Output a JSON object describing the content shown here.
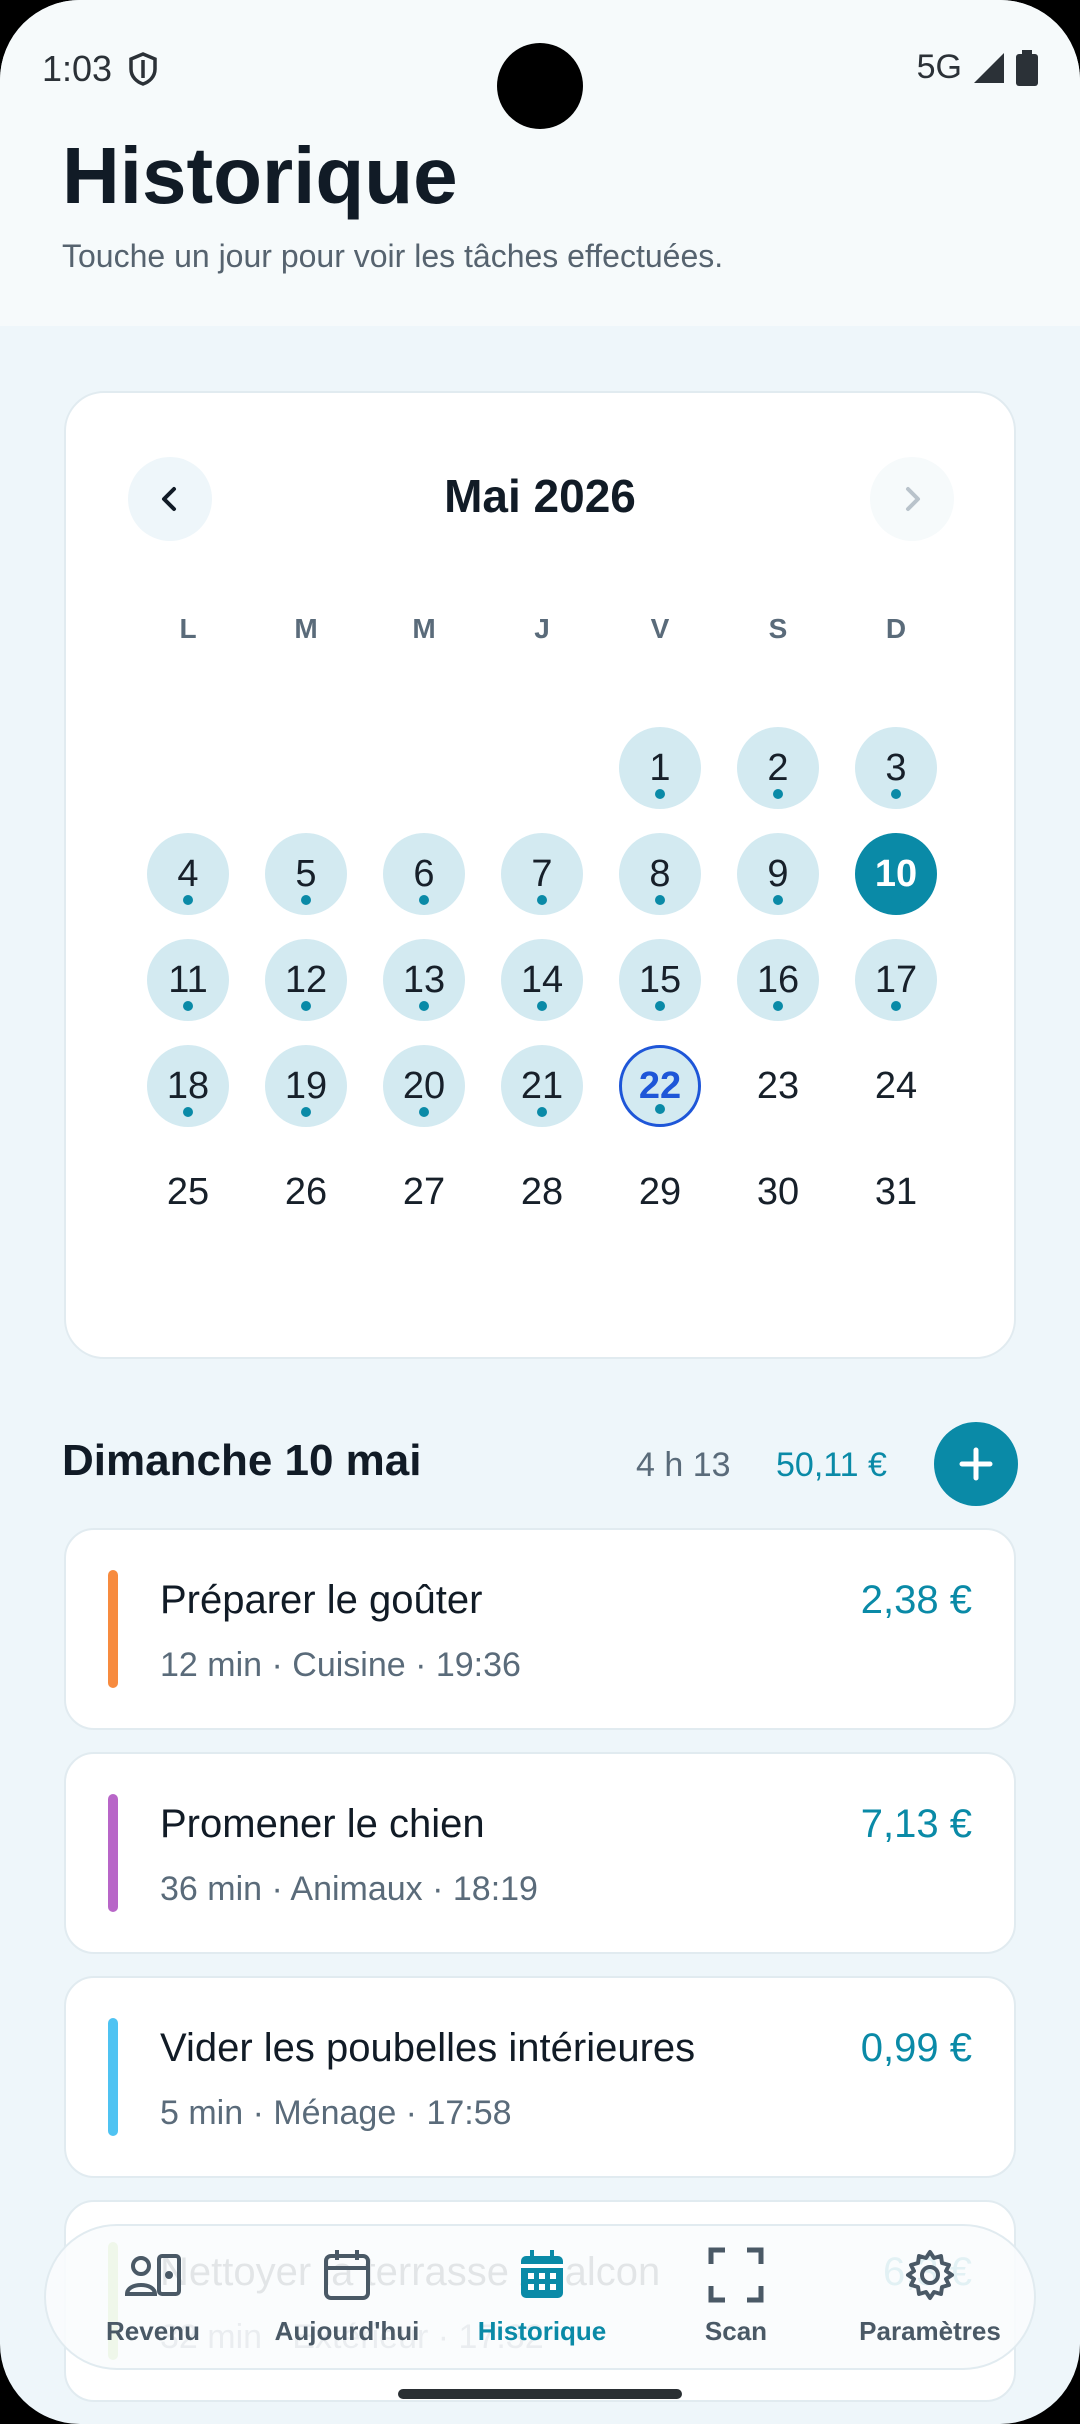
{
  "status": {
    "time": "1:03",
    "network": "5G"
  },
  "header": {
    "title": "Historique",
    "subtitle": "Touche un jour pour voir les tâches effectuées."
  },
  "calendar": {
    "month_label": "Mai 2026",
    "weekdays": [
      "L",
      "M",
      "M",
      "J",
      "V",
      "S",
      "D"
    ],
    "first_weekday_index": 4,
    "days_in_month": 31,
    "days_with_tasks": [
      1,
      2,
      3,
      4,
      5,
      6,
      7,
      8,
      9,
      10,
      11,
      12,
      13,
      14,
      15,
      16,
      17,
      18,
      19,
      20,
      21,
      22
    ],
    "selected_day": 10,
    "today": 22
  },
  "selected": {
    "title": "Dimanche 10 mai",
    "duration": "4 h 13",
    "total": "50,11 €"
  },
  "tasks": [
    {
      "name": "Préparer le goûter",
      "meta": "12 min · Cuisine · 19:36",
      "amount": "2,38 €",
      "color": "#f78b3f"
    },
    {
      "name": "Promener le chien",
      "meta": "36 min · Animaux · 18:19",
      "amount": "7,13 €",
      "color": "#b866c8"
    },
    {
      "name": "Vider les poubelles intérieures",
      "meta": "5 min · Ménage · 17:58",
      "amount": "0,99 €",
      "color": "#4fc3f2"
    },
    {
      "name": "Nettoyer la terrasse / balcon",
      "meta": "32 min · Extérieur · 17:32",
      "amount": "6,3 €",
      "color": "#8cc63f"
    }
  ],
  "nav": {
    "items": [
      {
        "label": "Revenu",
        "icon": "wallet-user-icon"
      },
      {
        "label": "Aujourd'hui",
        "icon": "calendar-icon"
      },
      {
        "label": "Historique",
        "icon": "calendar-grid-icon"
      },
      {
        "label": "Scan",
        "icon": "scan-frame-icon"
      },
      {
        "label": "Paramètres",
        "icon": "gear-icon"
      }
    ],
    "active": "Historique"
  },
  "colors": {
    "accent": "#0a8aa7",
    "today_ring": "#1e56d8",
    "has_task_bg": "#d3eaf1"
  }
}
